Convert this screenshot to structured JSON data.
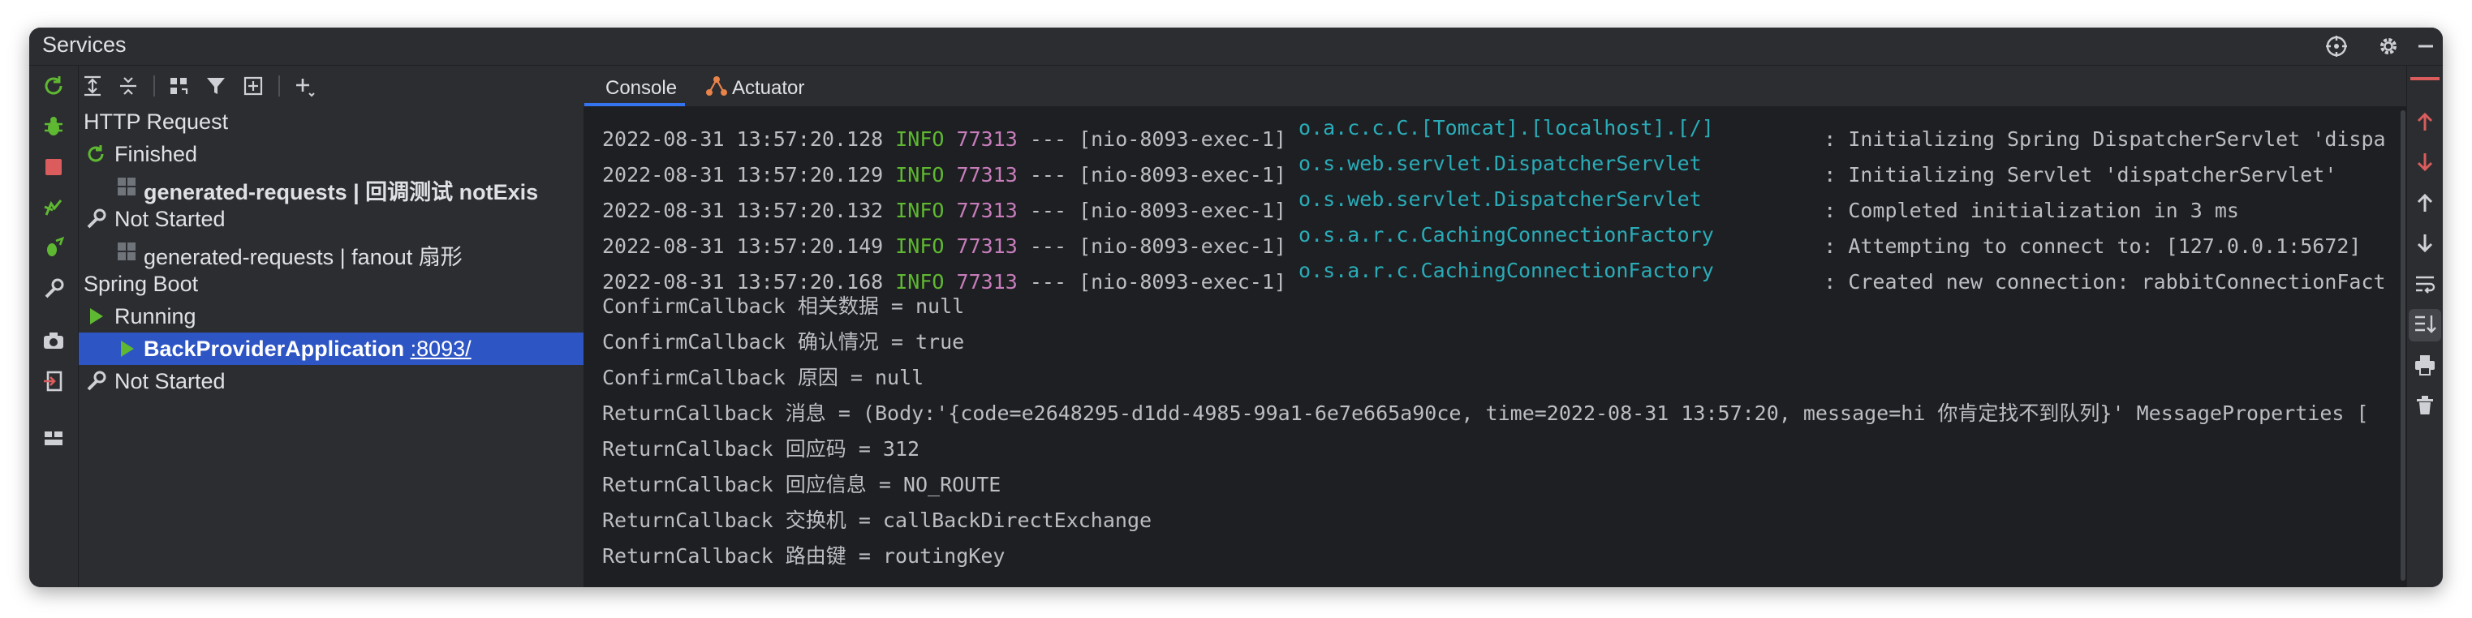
{
  "window": {
    "title": "Services"
  },
  "title_icons": [
    "target-icon",
    "gear-icon",
    "minimize-icon"
  ],
  "left_toolbar_icons": [
    "rerun-icon",
    "debug-icon",
    "stop-icon",
    "deploy-icon",
    "debug-deploy-icon",
    "wrench-icon",
    "camera-icon",
    "exit-icon",
    "layout-icon"
  ],
  "tree_toolbar_icons": [
    "expand-all-icon",
    "collapse-all-icon",
    "group-icon",
    "filter-icon",
    "new-service-icon",
    "add-icon"
  ],
  "tree": {
    "http_request": "HTTP Request",
    "finished": "Finished",
    "gen_requests_1": "generated-requests  |  回调测试 notExis",
    "not_started_1": "Not Started",
    "gen_requests_2": "generated-requests  |  fanout 扇形",
    "spring_boot": "Spring Boot",
    "running": "Running",
    "app_name": "BackProviderApplication",
    "app_port": ":8093/",
    "not_started_2": "Not Started"
  },
  "tabs": {
    "console": "Console",
    "actuator": "Actuator"
  },
  "log": [
    {
      "date": "2022-08-31 13:57:20.128",
      "level": "INFO",
      "pid": "77313",
      "sep": "---",
      "thread": "[nio-8093-exec-1]",
      "logger": "o.a.c.c.C.[Tomcat].[localhost].[/]",
      "msg": ": Initializing Spring DispatcherServlet 'dispa"
    },
    {
      "date": "2022-08-31 13:57:20.129",
      "level": "INFO",
      "pid": "77313",
      "sep": "---",
      "thread": "[nio-8093-exec-1]",
      "logger": "o.s.web.servlet.DispatcherServlet",
      "msg": ": Initializing Servlet 'dispatcherServlet'"
    },
    {
      "date": "2022-08-31 13:57:20.132",
      "level": "INFO",
      "pid": "77313",
      "sep": "---",
      "thread": "[nio-8093-exec-1]",
      "logger": "o.s.web.servlet.DispatcherServlet",
      "msg": ": Completed initialization in 3 ms"
    },
    {
      "date": "2022-08-31 13:57:20.149",
      "level": "INFO",
      "pid": "77313",
      "sep": "---",
      "thread": "[nio-8093-exec-1]",
      "logger": "o.s.a.r.c.CachingConnectionFactory",
      "msg": ": Attempting to connect to: [127.0.0.1:5672]"
    },
    {
      "date": "2022-08-31 13:57:20.168",
      "level": "INFO",
      "pid": "77313",
      "sep": "---",
      "thread": "[nio-8093-exec-1]",
      "logger": "o.s.a.r.c.CachingConnectionFactory",
      "msg": ": Created new connection: rabbitConnectionFact"
    }
  ],
  "plain_lines": [
    "ConfirmCallback 相关数据 = null",
    "ConfirmCallback 确认情况 = true",
    "ConfirmCallback 原因 = null",
    "ReturnCallback 消息 = (Body:'{code=e2648295-d1dd-4985-99a1-6e7e665a90ce, time=2022-08-31 13:57:20, message=hi 你肯定找不到队列}' MessageProperties [",
    "ReturnCallback 回应码 = 312",
    "ReturnCallback 回应信息 = NO_ROUTE",
    "ReturnCallback 交换机 = callBackDirectExchange",
    "ReturnCallback 路由键 = routingKey"
  ],
  "right_toolbar_icons": [
    "up-red-icon",
    "down-red-icon",
    "up-arrow-icon",
    "down-arrow-icon",
    "soft-wrap-icon",
    "scroll-to-end-icon",
    "print-icon",
    "trash-icon"
  ],
  "colors": {
    "info": "#5fb832",
    "pid": "#c77dbb",
    "logger": "#2aacb8",
    "selection": "#2e55c4",
    "accent": "#3574f0"
  }
}
